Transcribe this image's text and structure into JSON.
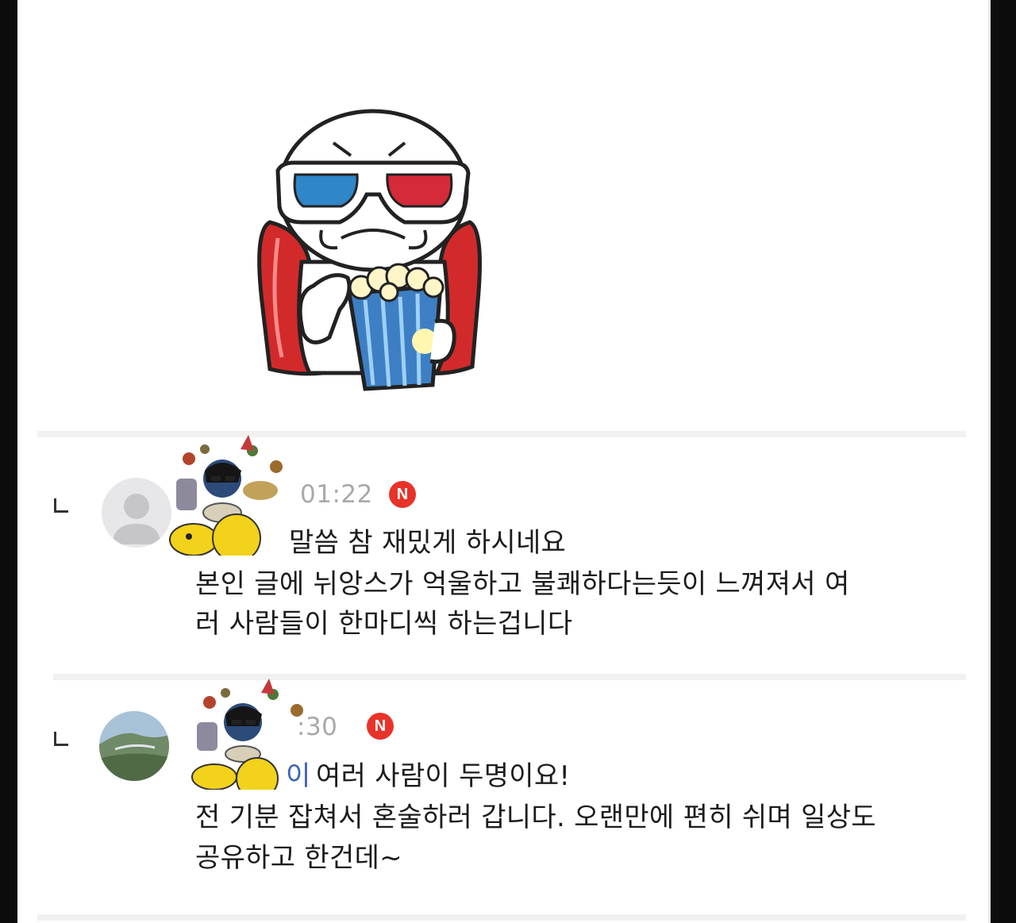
{
  "comments": [
    {
      "time": "01:22",
      "badge": "N",
      "lines": [
        "말씀 참 재밌게 하시네요",
        "본인 글에 뉘앙스가 억울하고 불쾌하다는듯이 느껴져서 여",
        "러 사람들이 한마디씩 하는겁니다"
      ]
    },
    {
      "time": ":30",
      "badge": "N",
      "mention": "이",
      "lines": [
        "여러 사람이 두명이요!",
        "전 기분 잡쳐서 혼술하러 갑니다. 오랜만에 편히 쉬며 일상도",
        "공유하고 한건데~"
      ]
    }
  ],
  "icons": {
    "sticker": "popcorn-3d-glasses-sticker",
    "reply": "reply-arrow-icon",
    "avatar_default": "default-avatar-icon",
    "avatar_photo": "landscape-avatar-photo",
    "decoration": "party-character-decoration"
  },
  "colors": {
    "new_badge": "#e8332a",
    "mention": "#3b63b8",
    "time": "#a9a9a9"
  }
}
